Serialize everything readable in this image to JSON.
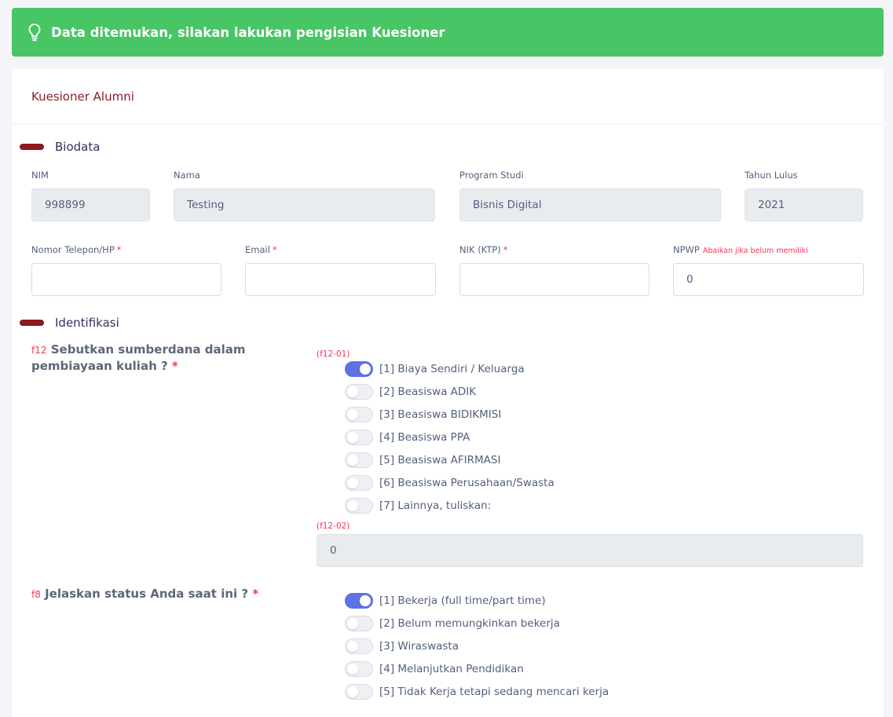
{
  "alert": {
    "icon": "lightbulb-icon",
    "text": "Data ditemukan, silakan lakukan pengisian Kuesioner"
  },
  "card": {
    "title": "Kuesioner Alumni"
  },
  "biodata": {
    "title": "Biodata",
    "nim": {
      "label": "NIM",
      "value": "998899"
    },
    "nama": {
      "label": "Nama",
      "value": "Testing"
    },
    "prodi": {
      "label": "Program Studi",
      "value": "Bisnis Digital"
    },
    "tahun_lulus": {
      "label": "Tahun Lulus",
      "value": "2021"
    },
    "telepon": {
      "label": "Nomor Telepon/HP",
      "required": "*",
      "value": ""
    },
    "email": {
      "label": "Email",
      "required": "*",
      "value": ""
    },
    "nik": {
      "label": "NIK (KTP)",
      "required": "*",
      "value": ""
    },
    "npwp": {
      "label": "NPWP",
      "hint": "Abaikan jika belum memiliki",
      "value": "0"
    }
  },
  "identifikasi": {
    "title": "Identifikasi",
    "f12": {
      "code": "f12",
      "question": "Sebutkan sumberdana dalam pembiayaan kuliah ?",
      "required": "*",
      "subcode": "(f12-01)",
      "options": [
        {
          "label": "[1] Biaya Sendiri / Keluarga",
          "checked": true
        },
        {
          "label": "[2] Beasiswa ADIK",
          "checked": false
        },
        {
          "label": "[3] Beasiswa BIDIKMISI",
          "checked": false
        },
        {
          "label": "[4] Beasiswa PPA",
          "checked": false
        },
        {
          "label": "[5] Beasiswa AFIRMASI",
          "checked": false
        },
        {
          "label": "[6] Beasiswa Perusahaan/Swasta",
          "checked": false
        },
        {
          "label": "[7] Lainnya, tuliskan:",
          "checked": false
        }
      ],
      "other_code": "(f12-02)",
      "other_value": "0"
    },
    "f8": {
      "code": "f8",
      "question": "Jelaskan status Anda saat ini ?",
      "required": "*",
      "options": [
        {
          "label": "[1] Bekerja (full time/part time)",
          "checked": true
        },
        {
          "label": "[2] Belum memungkinkan bekerja",
          "checked": false
        },
        {
          "label": "[3] Wiraswasta",
          "checked": false
        },
        {
          "label": "[4] Melanjutkan Pendidikan",
          "checked": false
        },
        {
          "label": "[5] Tidak Kerja tetapi sedang mencari kerja",
          "checked": false
        }
      ]
    }
  },
  "colors": {
    "alert_bg": "#48c565",
    "accent": "#8a1d25",
    "toggle_on": "#5e72e4",
    "required": "#f5365c"
  }
}
